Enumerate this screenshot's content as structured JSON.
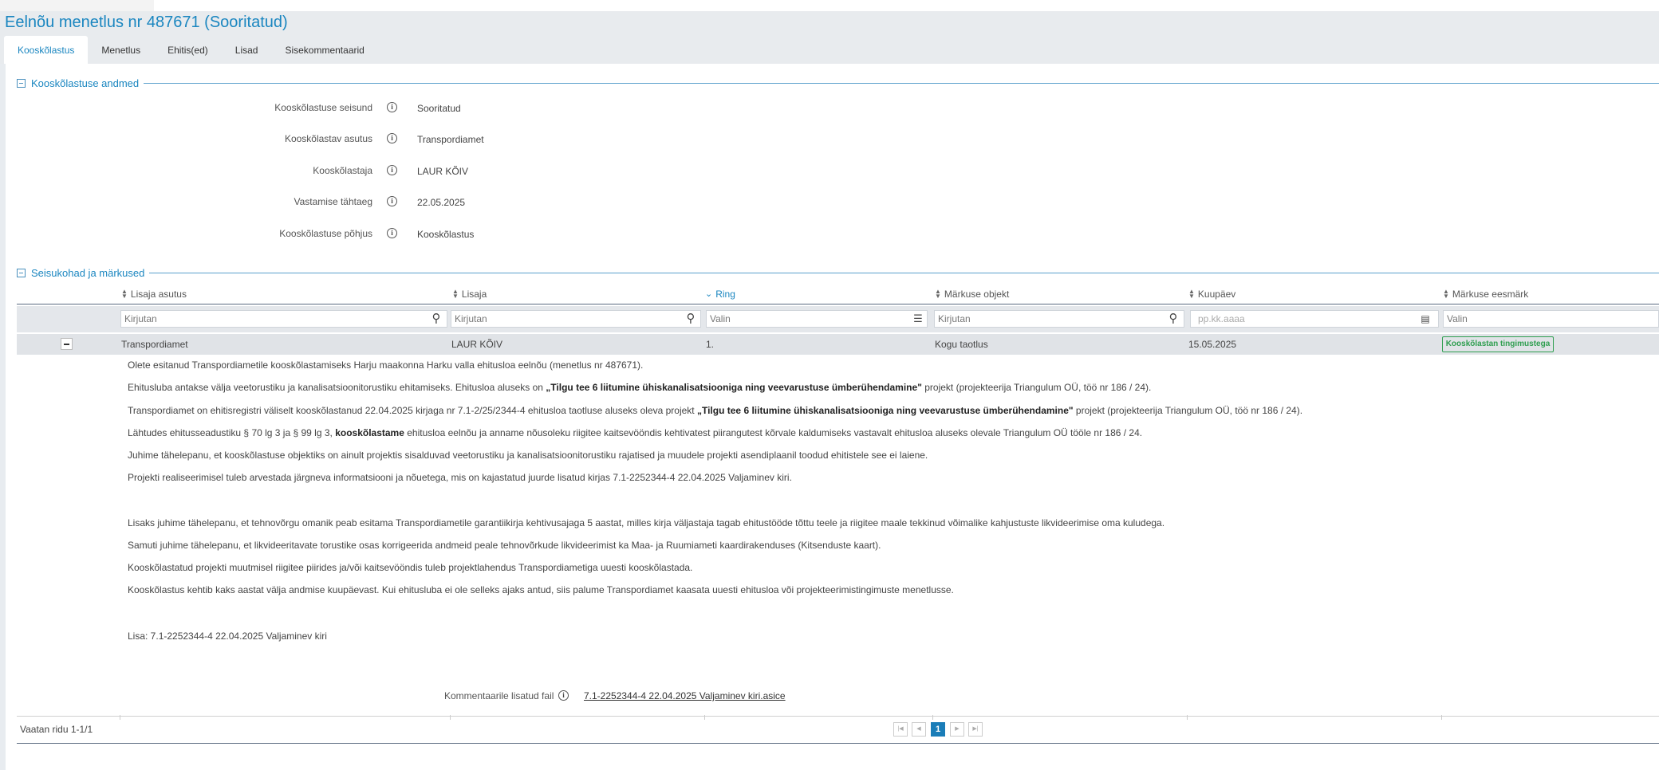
{
  "page": {
    "title": "Eelnõu menetlus nr 487671 (Sooritatud)"
  },
  "tabs": [
    {
      "label": "Kooskõlastus",
      "active": true
    },
    {
      "label": "Menetlus"
    },
    {
      "label": "Ehitis(ed)"
    },
    {
      "label": "Lisad"
    },
    {
      "label": "Sisekommentaarid"
    }
  ],
  "details_section": {
    "title": "Kooskõlastuse andmed",
    "fields": [
      {
        "label": "Kooskõlastuse seisund",
        "value": "Sooritatud"
      },
      {
        "label": "Kooskõlastav asutus",
        "value": "Transpordiamet"
      },
      {
        "label": "Kooskõlastaja",
        "value": "LAUR KÕIV"
      },
      {
        "label": "Vastamise tähtaeg",
        "value": "22.05.2025"
      },
      {
        "label": "Kooskõlastuse põhjus",
        "value": "Kooskõlastus"
      }
    ]
  },
  "remarks_section": {
    "title": "Seisukohad ja märkused",
    "columns": [
      "Lisaja asutus",
      "Lisaja",
      "Ring",
      "Märkuse objekt",
      "Kuupäev",
      "Märkuse eesmärk"
    ],
    "filters": {
      "text_placeholder": "Kirjutan",
      "select_placeholder": "Valin",
      "date_placeholder": "pp.kk.aaaa"
    },
    "row": {
      "agency": "Transpordiamet",
      "author": "LAUR KÕIV",
      "round": "1.",
      "object": "Kogu taotlus",
      "date": "15.05.2025",
      "purpose": "Kooskõlastan tingimustega"
    },
    "comment": {
      "p1": "Olete esitanud Transpordiametile kooskõlastamiseks Harju maakonna Harku valla ehitusloa eelnõu (menetlus nr 487671).",
      "p2_pre": "Ehitusluba antakse välja veetorustiku ja kanalisatsioonitorustiku ehitamiseks. Ehitusloa aluseks on ",
      "p2_bold": "„Tilgu tee 6 liitumine ühiskanalisatsiooniga ning veevarustuse ümberühendamine\"",
      "p2_post": " projekt (projekteerija Triangulum OÜ, töö nr 186 / 24).",
      "p3_pre": "Transpordiamet on ehitisregistri väliselt kooskõlastanud 22.04.2025 kirjaga nr 7.1-2/25/2344-4 ehitusloa taotluse aluseks oleva projekt ",
      "p3_bold": "„Tilgu tee 6 liitumine ühiskanalisatsiooniga ning veevarustuse ümberühendamine\"",
      "p3_post": " projekt (projekteerija Triangulum OÜ, töö nr 186 / 24).",
      "p4_pre": "Lähtudes ehitusseadustiku § 70 lg 3 ja § 99 lg 3, ",
      "p4_bold": "kooskõlastame",
      "p4_post": " ehitusloa eelnõu ja anname nõusoleku riigitee kaitsevööndis kehtivatest piirangutest kõrvale kaldumiseks vastavalt ehitusloa aluseks olevale Triangulum OÜ tööle nr 186 / 24.",
      "p5": "Juhime tähelepanu, et kooskõlastuse objektiks on ainult projektis sisalduvad veetorustiku ja kanalisatsioonitorustiku rajatised ja muudele projekti asendiplaanil toodud ehitistele see ei laiene.",
      "p6": "Projekti realiseerimisel tuleb arvestada järgneva informatsiooni ja nõuetega, mis on kajastatud juurde lisatud kirjas 7.1-2252344-4 22.04.2025 Valjaminev kiri.",
      "p7": "Lisaks juhime tähelepanu, et tehnovõrgu omanik peab esitama Transpordiametile garantiikirja kehtivusajaga 5 aastat, milles kirja väljastaja tagab ehitustööde tõttu teele ja riigitee maale tekkinud võimalike kahjustuste likvideerimise oma kuludega.",
      "p8": "Samuti juhime tähelepanu, et likvideeritavate torustike osas korrigeerida andmeid peale tehnovõrkude likvideerimist ka Maa- ja Ruumiameti kaardirakenduses (Kitsenduste kaart).",
      "p9": "Kooskõlastatud projekti muutmisel riigitee piirides ja/või kaitsevööndis tuleb projektlahendus Transpordiametiga uuesti kooskõlastada.",
      "p10": "Kooskõlastus kehtib kaks aastat välja andmise kuupäevast. Kui ehitusluba ei ole selleks ajaks antud, siis palume Transpordiamet kaasata uuesti ehitusloa või projekteerimistingimuste menetlusse.",
      "p11": "Lisa: 7.1-2252344-4 22.04.2025 Valjaminev kiri"
    },
    "attachment": {
      "label": "Kommentaarile lisatud fail",
      "file": "7.1-2252344-4 22.04.2025 Valjaminev kiri.asice"
    }
  },
  "footer": {
    "rows_text": "Vaatan ridu 1-1/1",
    "current_page": "1"
  }
}
